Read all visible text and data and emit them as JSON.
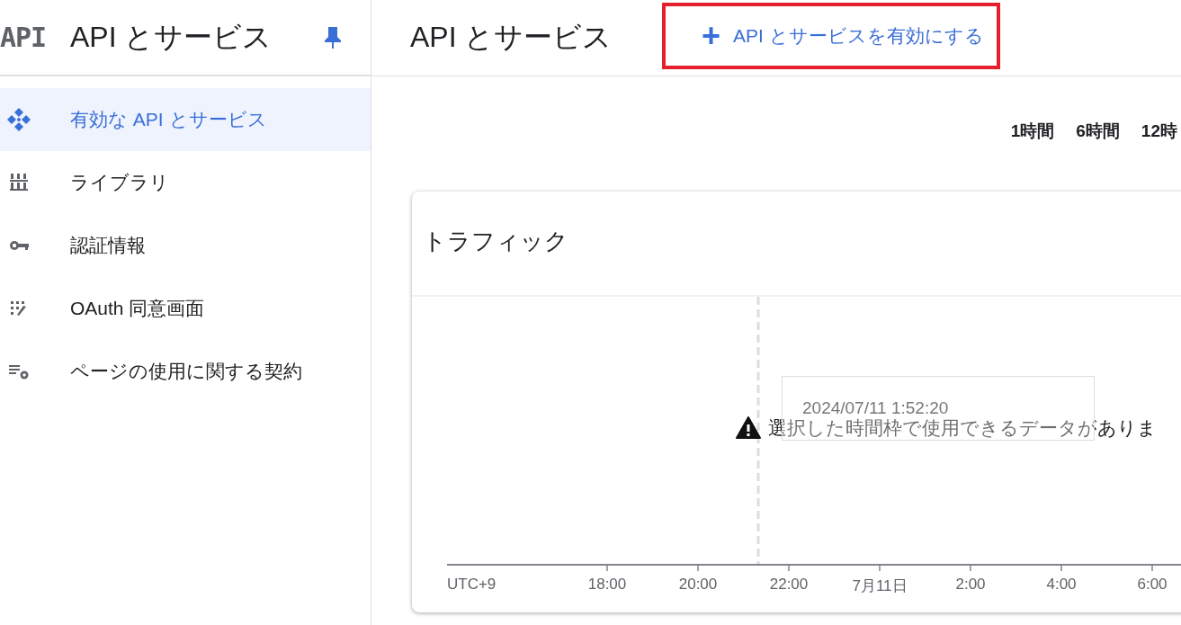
{
  "sidebar": {
    "logo": "API",
    "title": "API とサービス",
    "items": [
      {
        "label": "有効な API とサービス",
        "selected": true
      },
      {
        "label": "ライブラリ",
        "selected": false
      },
      {
        "label": "認証情報",
        "selected": false
      },
      {
        "label": "OAuth 同意画面",
        "selected": false
      },
      {
        "label": "ページの使用に関する契約",
        "selected": false
      }
    ]
  },
  "header": {
    "title": "API とサービス",
    "action": {
      "icon": "+",
      "label": "API とサービスを有効にする",
      "highlighted": true
    }
  },
  "time_ranges": [
    "1時間",
    "6時間",
    "12時"
  ],
  "traffic_card": {
    "title": "トラフィック",
    "message": "選択した時間枠で使用できるデータがありま",
    "tooltip": "2024/07/11 1:52:20",
    "axis_labels": [
      "UTC+9",
      "18:00",
      "20:00",
      "22:00",
      "7月11日",
      "2:00",
      "4:00",
      "6:00"
    ]
  }
}
